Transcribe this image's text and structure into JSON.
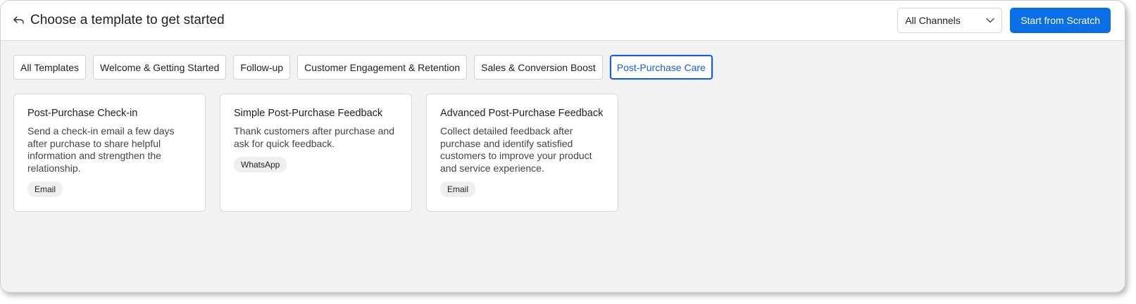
{
  "header": {
    "title": "Choose a template to get started",
    "channel_select": "All Channels",
    "primary_button": "Start from Scratch"
  },
  "tabs": [
    {
      "label": "All Templates"
    },
    {
      "label": "Welcome & Getting Started"
    },
    {
      "label": "Follow-up"
    },
    {
      "label": "Customer Engagement & Retention"
    },
    {
      "label": "Sales & Conversion Boost"
    },
    {
      "label": "Post-Purchase Care",
      "active": true
    }
  ],
  "cards": [
    {
      "title": "Post-Purchase Check-in",
      "description": "Send a check-in email a few days after purchase to share helpful information and strengthen the relationship.",
      "channel": "Email"
    },
    {
      "title": "Simple Post-Purchase Feedback",
      "description": "Thank customers after purchase and ask for quick feedback.",
      "channel": "WhatsApp"
    },
    {
      "title": "Advanced Post-Purchase Feedback",
      "description": "Collect detailed feedback after purchase and identify satisfied customers to improve your product and service experience.",
      "channel": "Email"
    }
  ],
  "icons": {
    "back": "back-arrow-icon",
    "dropdown": "chevron-down-icon"
  },
  "colors": {
    "accent": "#0a6ee6",
    "active_tab": "#1a5cd6",
    "background": "#f2f2f2"
  }
}
